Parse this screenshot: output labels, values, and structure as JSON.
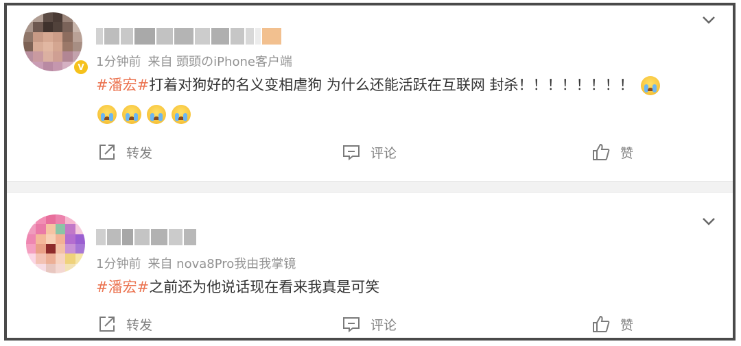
{
  "posts": [
    {
      "time": "1分钟前",
      "source": "来自 頭頭のiPhone客户端",
      "topic": "#潘宏#",
      "text": "打着对狗好的名义变相虐狗 为什么还能活跃在互联网 封杀！！！！！！！！",
      "emoji": [
        "crying-emoji",
        "crying-emoji",
        "crying-emoji",
        "crying-emoji",
        "crying-emoji"
      ],
      "actions": {
        "repost": "转发",
        "comment": "评论",
        "like": "赞"
      }
    },
    {
      "time": "1分钟前",
      "source": "来自 nova8Pro我由我掌镜",
      "topic": "#潘宏#",
      "text": "之前还为他说话现在看来我真是可笑",
      "actions": {
        "repost": "转发",
        "comment": "评论",
        "like": "赞"
      }
    }
  ],
  "colors": {
    "topic": "#eb7350",
    "meta": "#939393",
    "border": "#4a4a4a",
    "divider": "#f2f2f2"
  }
}
